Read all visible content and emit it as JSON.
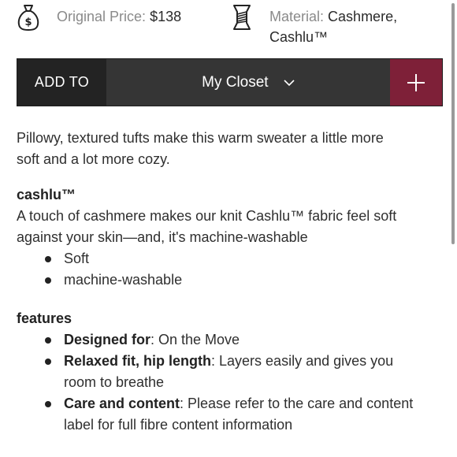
{
  "meta": {
    "price_label": "Original Price:",
    "price_value": "$138",
    "material_label": "Material:",
    "material_value_line1": "Cashmere,",
    "material_value_line2": "Cashlu™"
  },
  "add_bar": {
    "add_to_label": "ADD TO",
    "closet_label": "My Closet",
    "plus_icon": "plus-icon"
  },
  "description": {
    "intro_line1": "Pillowy, textured tufts make this warm sweater a little more",
    "intro_line2": "soft and a lot more cozy.",
    "cashlu_heading": "cashlu™",
    "cashlu_line1": "A touch of cashmere makes our knit Cashlu™ fabric feel soft",
    "cashlu_line2": "against your skin—and, it's machine-washable",
    "cashlu_bullets": [
      "Soft",
      "machine-washable"
    ],
    "features_heading": "features",
    "features": [
      {
        "label": "Designed for",
        "text": ": On the Move",
        "text2": ""
      },
      {
        "label": "Relaxed fit, hip length",
        "text": ": Layers easily and gives you",
        "text2": "room to breathe"
      },
      {
        "label": "Care and content",
        "text": ": Please refer to the care and content",
        "text2": "label for full fibre content information"
      }
    ]
  },
  "colors": {
    "accent": "#7e2038",
    "bar": "#333333",
    "bar_dark": "#232323"
  }
}
